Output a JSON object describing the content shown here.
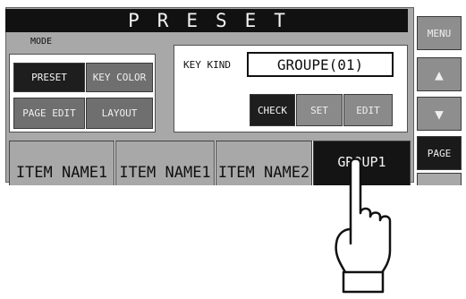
{
  "header": {
    "title": "PRESET"
  },
  "mode": {
    "label": "MODE",
    "buttons": {
      "preset": "PRESET",
      "key_color": "KEY COLOR",
      "page_edit": "PAGE EDIT",
      "layout": "LAYOUT"
    },
    "active": "preset"
  },
  "key_kind": {
    "label": "KEY KIND",
    "value": "GROUPE(01)",
    "buttons": {
      "check": "CHECK",
      "set": "SET",
      "edit": "EDIT"
    },
    "active": "check"
  },
  "side_menu": {
    "menu": "MENU",
    "up_arrow": "▲",
    "down_arrow": "▼",
    "page": "PAGE"
  },
  "item_row": {
    "items": [
      "ITEM NAME1",
      "ITEM NAME1",
      "ITEM NAME2",
      "GROUP1"
    ],
    "selected_index": 3
  },
  "colors": {
    "panel_gray": "#a8a8a8",
    "button_gray": "#6f6f6f",
    "active_black": "#1e1e1e",
    "text_light": "#f0f0f0"
  },
  "icons": {
    "pointer": "pointing-hand-icon"
  }
}
